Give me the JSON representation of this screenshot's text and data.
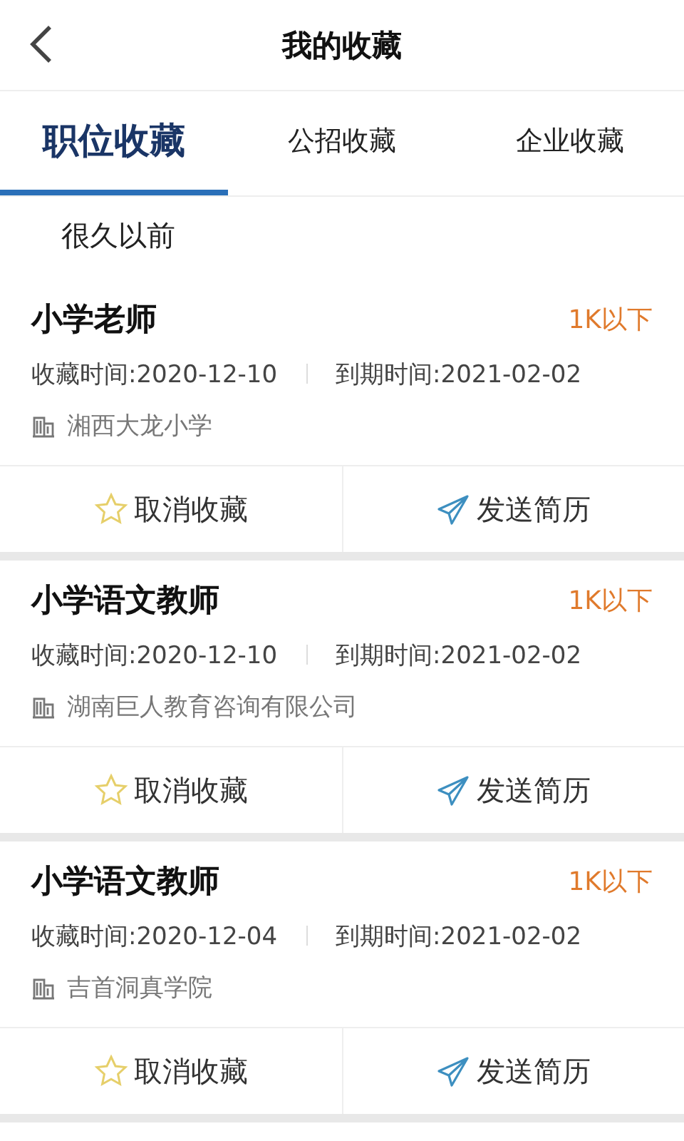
{
  "header": {
    "title": "我的收藏"
  },
  "tabs": [
    {
      "label": "职位收藏",
      "selected": true
    },
    {
      "label": "公招收藏",
      "selected": false
    },
    {
      "label": "企业收藏",
      "selected": false
    }
  ],
  "section_label": "很久以前",
  "jobs": [
    {
      "title": "小学老师",
      "salary": "1K以下",
      "saved_time": "收藏时间:2020-12-10",
      "expiry_time": "到期时间:2021-02-02",
      "company": "湘西大龙小学",
      "actions": [
        "取消收藏",
        "发送简历"
      ]
    },
    {
      "title": "小学语文教师",
      "salary": "1K以下",
      "saved_time": "收藏时间:2020-12-10",
      "expiry_time": "到期时间:2021-02-02",
      "company": "湖南巨人教育咨询有限公司",
      "actions": [
        "取消收藏",
        "发送简历"
      ]
    },
    {
      "title": "小学语文教师",
      "salary": "1K以下",
      "saved_time": "收藏时间:2020-12-04",
      "expiry_time": "到期时间:2021-02-02",
      "company": "吉首洞真学院",
      "actions": [
        "取消收藏",
        "发送简历"
      ]
    }
  ]
}
